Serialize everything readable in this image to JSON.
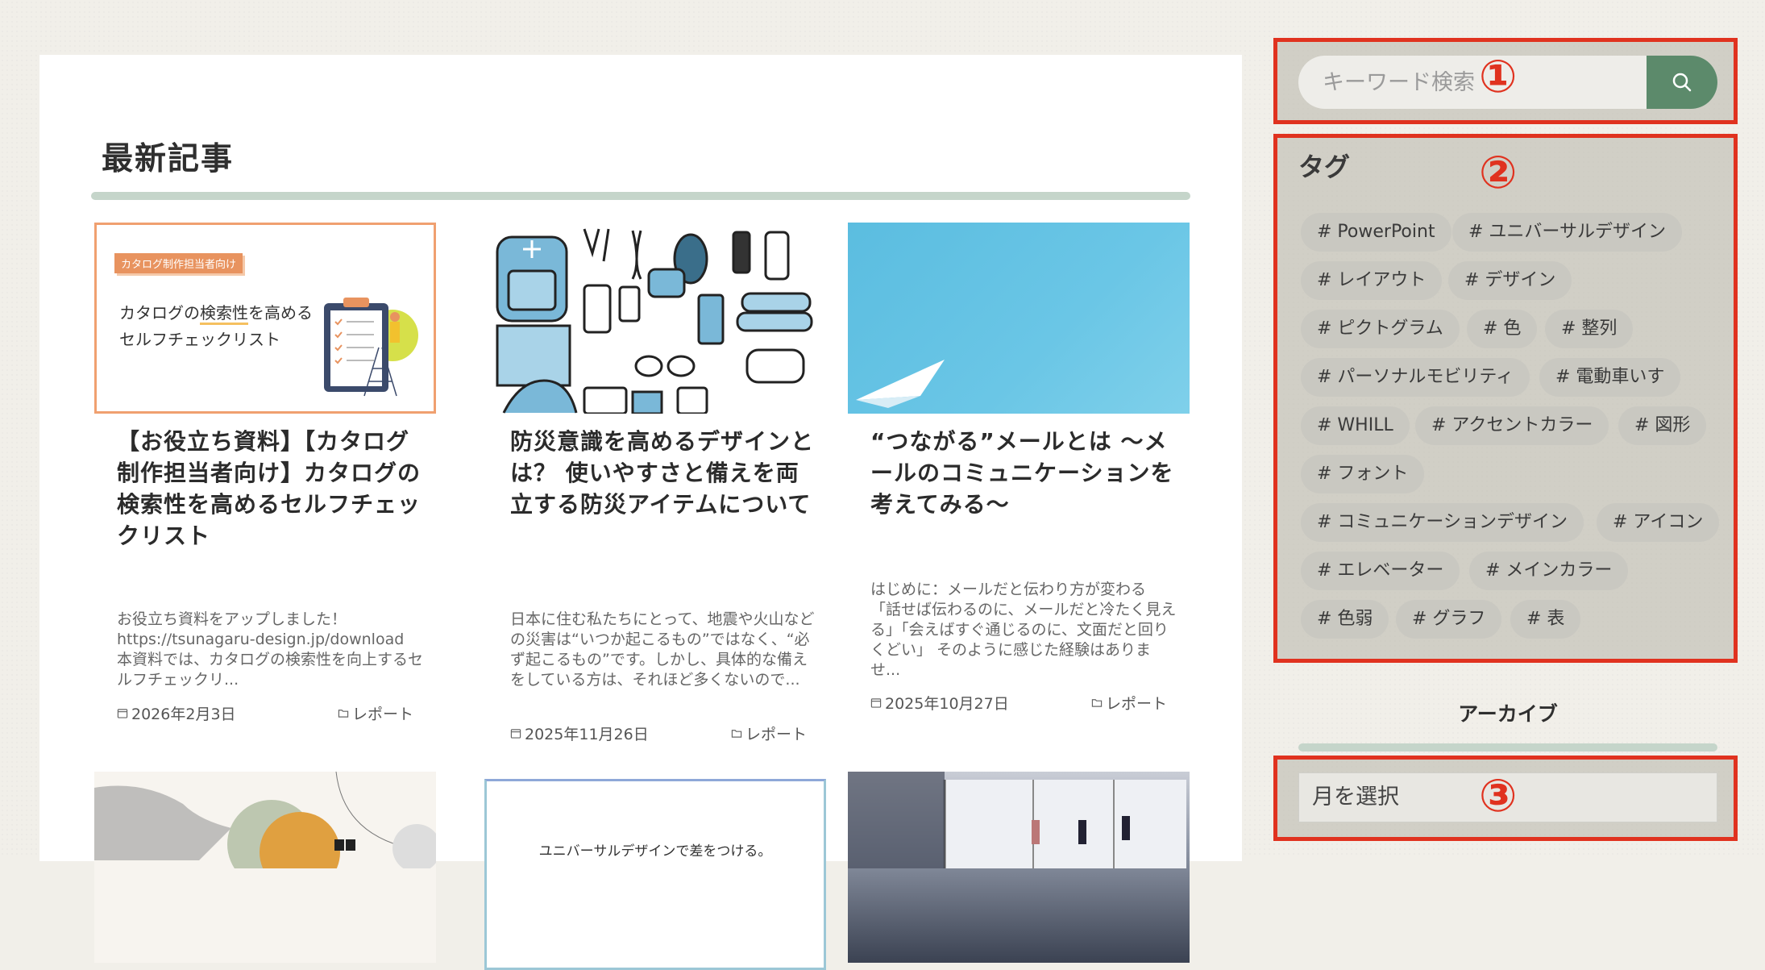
{
  "main": {
    "section_title": "最新記事",
    "cards": [
      {
        "thumb_tag": "カタログ制作担当者向け",
        "thumb_line1_a": "カタログの",
        "thumb_line1_b": "検索性",
        "thumb_line1_c": "を高める",
        "thumb_line2": "セルフチェックリスト",
        "title": "【お役立ち資料】【カタログ制作担当者向け】カタログの検索性を高めるセルフチェックリスト",
        "excerpt": "お役立ち資料をアップしました！ https://tsunagaru-design.jp/download 本資料では、カタログの検索性を向上するセルフチェックリ...",
        "date": "2026年2月3日",
        "category": "レポート"
      },
      {
        "title": "防災意識を高めるデザインとは？ 使いやすさと備えを両立する防災アイテムについて",
        "excerpt": "日本に住む私たちにとって、地震や火山などの災害は“いつか起こるもの”ではなく、“必ず起こるもの”です。しかし、具体的な備えをしている方は、それほど多くないので...",
        "date": "2025年11月26日",
        "category": "レポート"
      },
      {
        "title": "“つながる”メールとは 〜メールのコミュニケーションを考えてみる〜",
        "excerpt": "はじめに：メールだと伝わり方が変わる 「話せば伝わるのに、メールだと冷たく見える」「会えばすぐ通じるのに、文面だと回りくどい」 そのように感じた経験はありませ...",
        "date": "2025年10月27日",
        "category": "レポート"
      }
    ],
    "second_row_card2_text": "ユニバーサルデザインで差をつける。"
  },
  "sidebar": {
    "search": {
      "placeholder": "キーワード検索"
    },
    "tags_title": "タグ",
    "tags": [
      "# PowerPoint",
      "# ユニバーサルデザイン",
      "# レイアウト",
      "# デザイン",
      "# ピクトグラム",
      "# 色",
      "# 整列",
      "# パーソナルモビリティ",
      "# 電動車いす",
      "# WHILL",
      "# アクセントカラー",
      "# 図形",
      "# フォント",
      "# コミュニケーションデザイン",
      "# アイコン",
      "# エレベーター",
      "# メインカラー",
      "# 色弱",
      "# グラフ",
      "# 表"
    ],
    "archive_title": "アーカイブ",
    "month_select": "月を選択"
  },
  "annotations": {
    "n1": "①",
    "n2": "②",
    "n3": "③"
  },
  "colors": {
    "accent_green": "#5c8a6b",
    "annotation_red": "#e0321f",
    "divider": "#c5d5ca"
  }
}
